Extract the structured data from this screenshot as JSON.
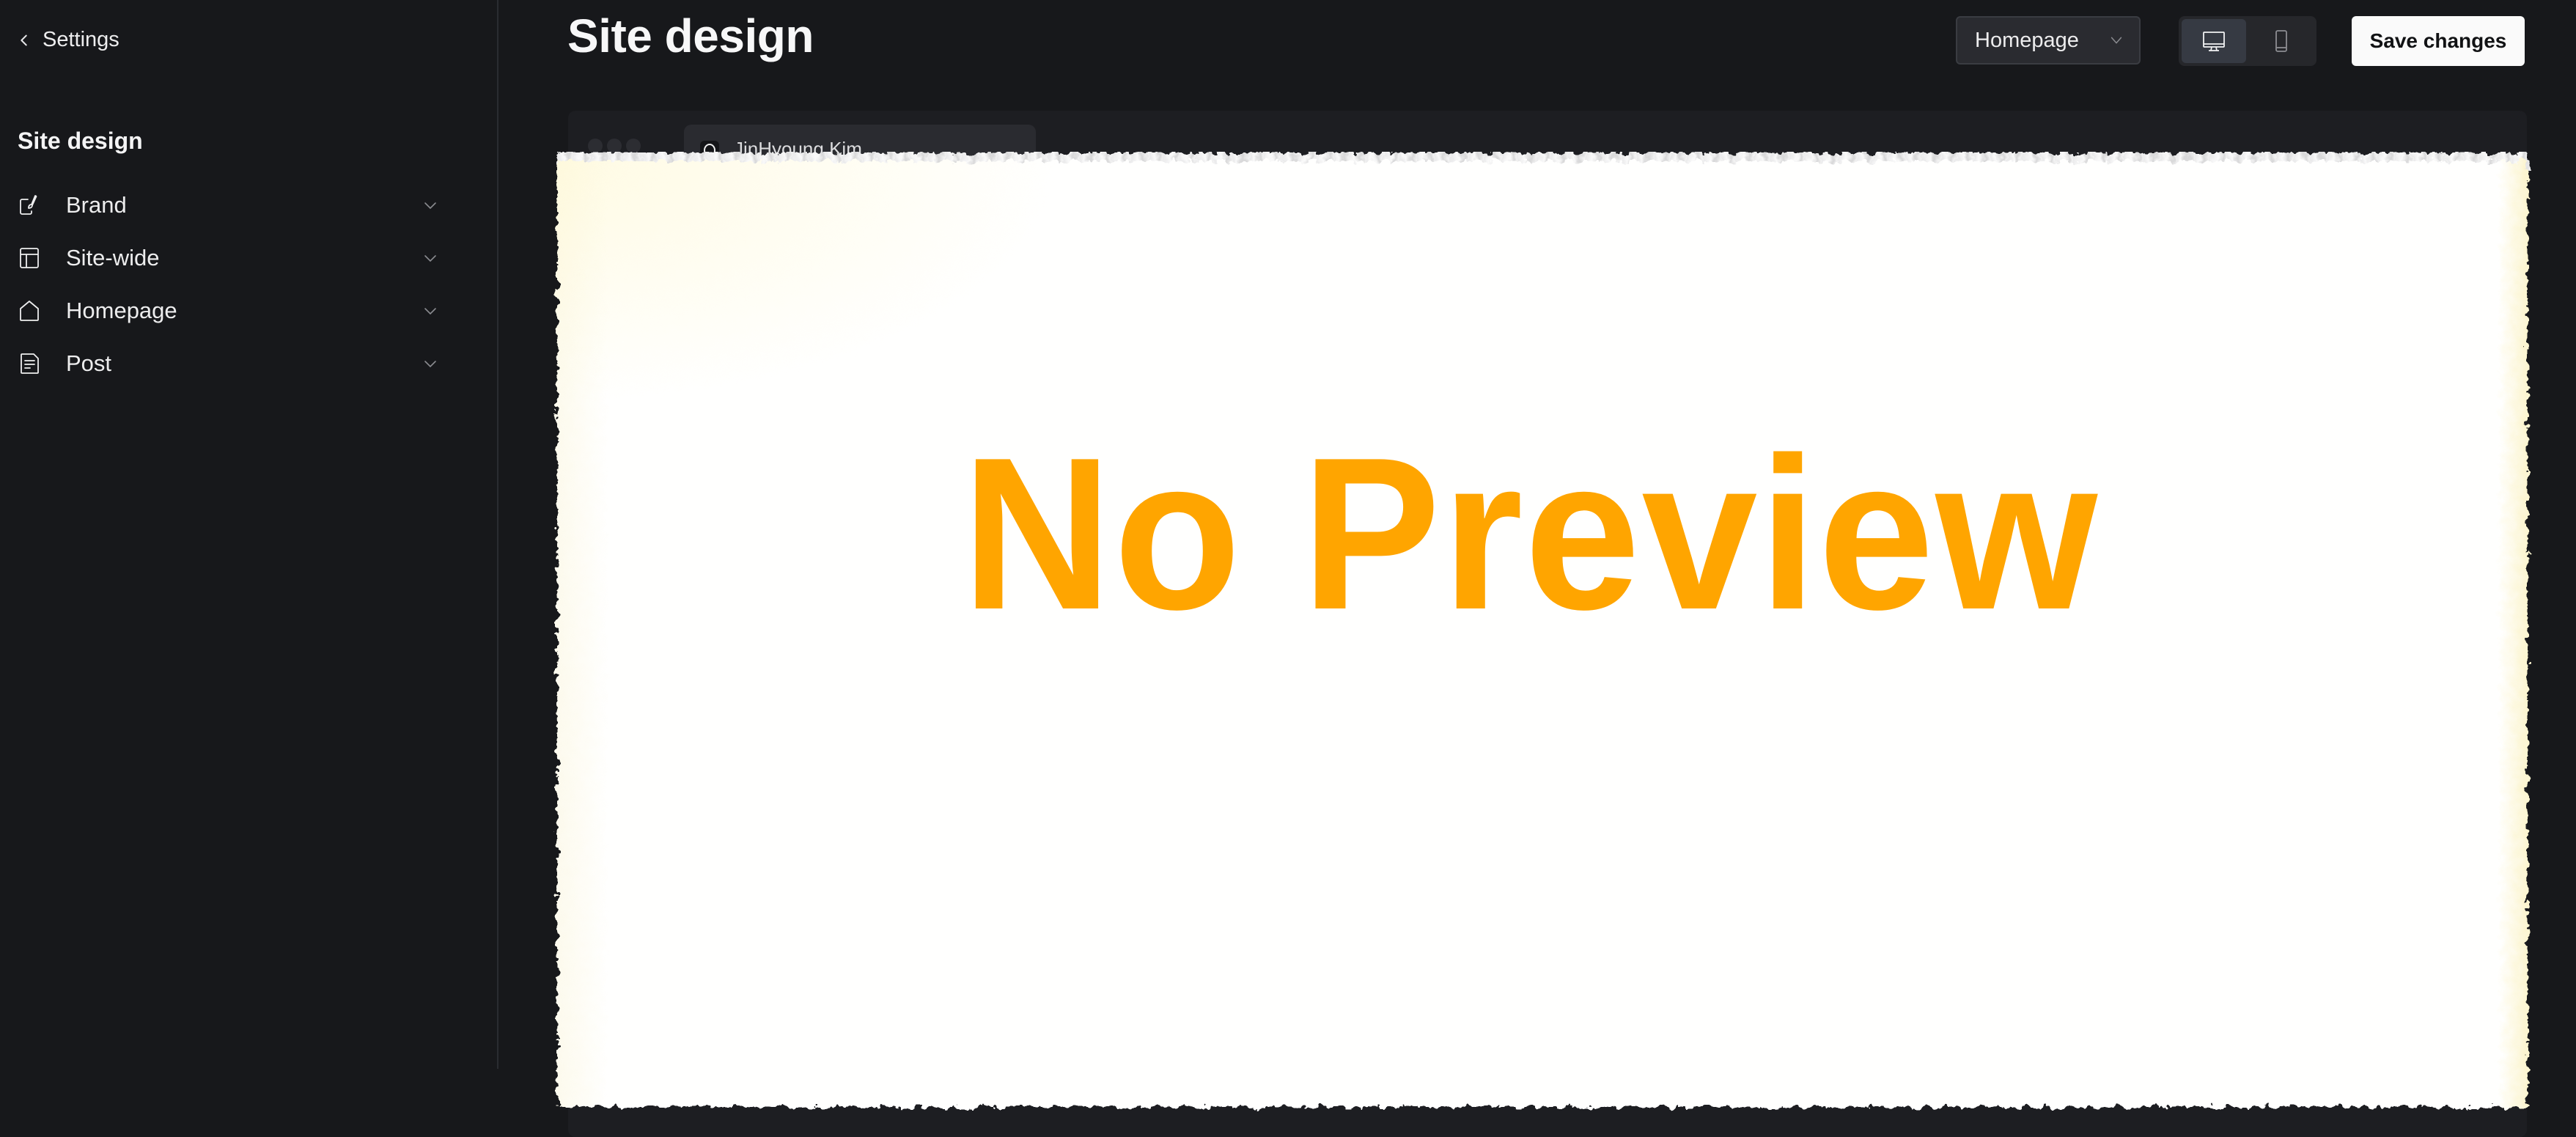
{
  "sidebar": {
    "back_label": "Settings",
    "heading": "Site design",
    "items": [
      {
        "label": "Brand",
        "icon": "paintbrush-edit-icon"
      },
      {
        "label": "Site-wide",
        "icon": "layout-icon"
      },
      {
        "label": "Homepage",
        "icon": "home-icon"
      },
      {
        "label": "Post",
        "icon": "document-icon"
      }
    ]
  },
  "header": {
    "title": "Site design",
    "page_select": {
      "value": "Homepage"
    },
    "device_toggle": {
      "options": [
        "desktop",
        "mobile"
      ],
      "selected": "desktop"
    },
    "save_label": "Save changes"
  },
  "preview": {
    "tab_title": "JinHyoung Kim",
    "overlay_text": "No Preview",
    "overlay_color": "#ffa500"
  }
}
